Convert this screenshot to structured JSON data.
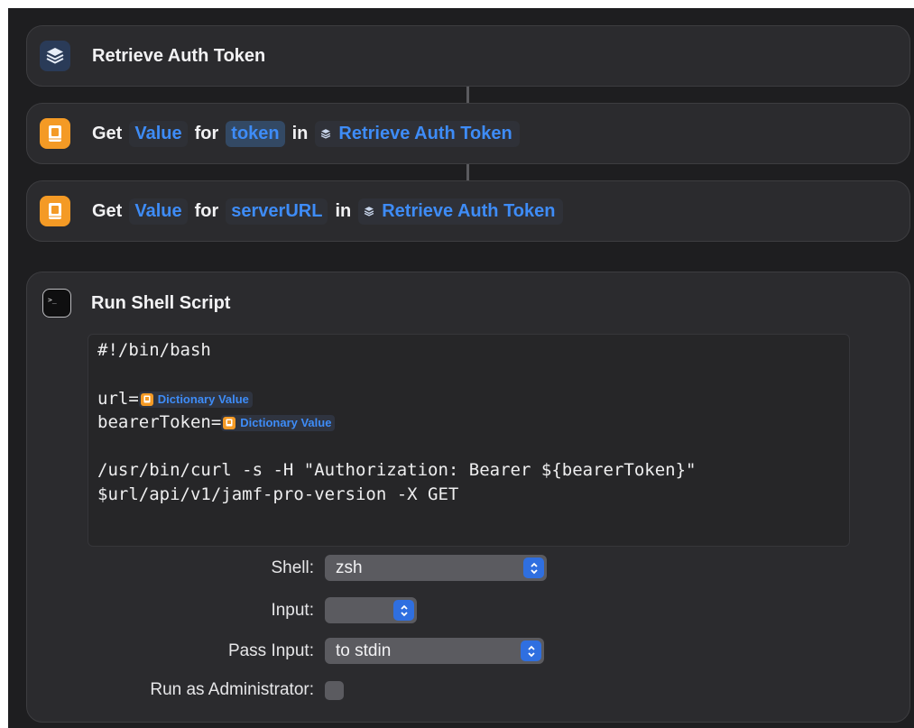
{
  "actions": {
    "retrieve": {
      "title": "Retrieve Auth Token"
    },
    "get_token": {
      "verb": "Get",
      "value_token": "Value",
      "for_word": "for",
      "key_token": "token",
      "in_word": "in",
      "ref": "Retrieve Auth Token"
    },
    "get_server": {
      "verb": "Get",
      "value_token": "Value",
      "for_word": "for",
      "key_token": "serverURL",
      "in_word": "in",
      "ref": "Retrieve Auth Token"
    },
    "shell": {
      "title": "Run Shell Script",
      "script": {
        "line1": "#!/bin/bash",
        "url_prefix": "url=",
        "bearer_prefix": "bearerToken=",
        "var_label": "Dictionary Value",
        "curl_line1": "/usr/bin/curl -s -H \"Authorization: Bearer ${bearerToken}\"",
        "curl_line2": "$url/api/v1/jamf-pro-version -X GET"
      },
      "shell_label": "Shell:",
      "shell_value": "zsh",
      "input_label": "Input:",
      "input_value": "",
      "pass_input_label": "Pass Input:",
      "pass_input_value": "to stdin",
      "run_as_admin_label": "Run as Administrator:"
    }
  },
  "colors": {
    "accent": "#3e8cf7",
    "dictionary_icon": "#f49a25",
    "card_bg": "#2b2b2e",
    "canvas_bg": "#1e1e20"
  },
  "icons": {
    "retrieve": "layers-icon",
    "dictionary": "dictionary-icon",
    "terminal": "terminal-icon",
    "chevron": "chevron-updown-icon"
  }
}
